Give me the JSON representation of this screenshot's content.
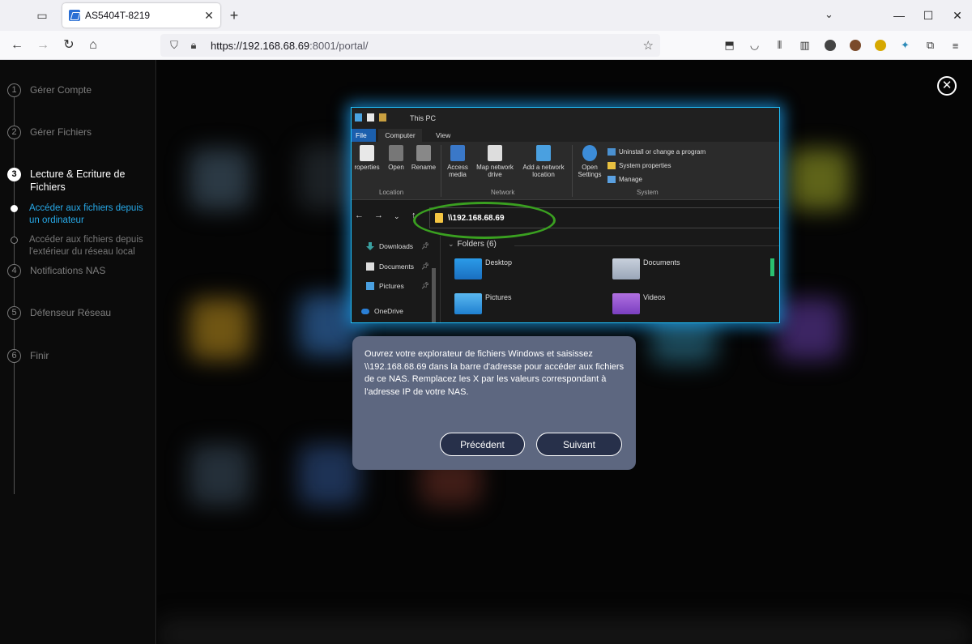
{
  "browser": {
    "tab_title": "AS5404T-8219",
    "url_host": "https://192.168.68.69",
    "url_rest": ":8001/portal/"
  },
  "sidebar": {
    "steps": [
      {
        "num": "1",
        "label": "Gérer Compte"
      },
      {
        "num": "2",
        "label": "Gérer Fichiers"
      },
      {
        "num": "3",
        "label": "Lecture & Ecriture de Fichiers"
      },
      {
        "num": "4",
        "label": "Notifications NAS"
      },
      {
        "num": "5",
        "label": "Défenseur Réseau"
      },
      {
        "num": "6",
        "label": "Finir"
      }
    ],
    "substeps": [
      {
        "label": "Accéder aux fichiers depuis un ordinateur"
      },
      {
        "label": "Accéder aux fichiers depuis l'extérieur du réseau local"
      }
    ]
  },
  "explorer": {
    "title": "This PC",
    "menu": {
      "file": "File",
      "computer": "Computer",
      "view": "View"
    },
    "ribbon": {
      "properties": "roperties",
      "open": "Open",
      "rename": "Rename",
      "location_group": "Location",
      "access_media": "Access media",
      "map_network_drive": "Map network drive",
      "add_network_location": "Add a network location",
      "network_group": "Network",
      "open_settings": "Open Settings",
      "uninstall": "Uninstall or change a program",
      "system_properties": "System properties",
      "manage": "Manage",
      "system_group": "System"
    },
    "address": "\\\\192.168.68.69",
    "nav": [
      {
        "label": "Downloads"
      },
      {
        "label": "Documents"
      },
      {
        "label": "Pictures"
      },
      {
        "label": "OneDrive"
      }
    ],
    "folders_header": "Folders (6)",
    "folders": [
      "Desktop",
      "Documents",
      "Pictures",
      "Videos"
    ]
  },
  "dialog": {
    "text": "Ouvrez votre explorateur de fichiers Windows et saisissez \\\\192.168.68.69 dans la barre d'adresse pour accéder aux fichiers de ce NAS. Remplacez les X par les valeurs correspondant à l'adresse IP de votre NAS.",
    "prev_label": "Précédent",
    "next_label": "Suivant"
  },
  "colors": {
    "accent": "#27a9e8",
    "explorer_glow": "#1fc3ff",
    "highlight_oval": "#3aa020",
    "dialog_bg": "#5d6780"
  }
}
